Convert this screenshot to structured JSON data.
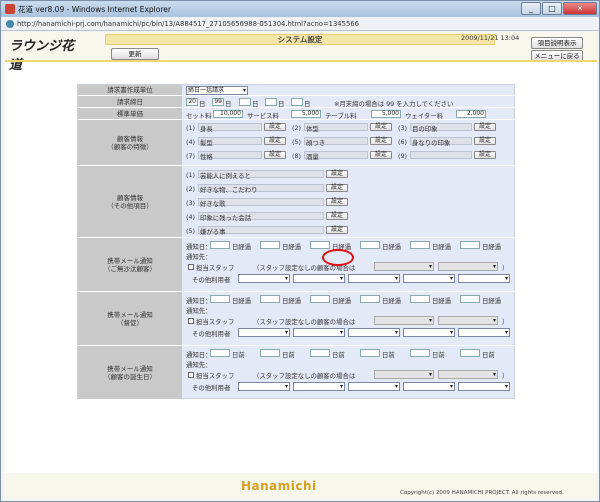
{
  "window": {
    "title": "花道 ver8.09 - Windows Internet Explorer",
    "minimize": "_",
    "maximize": "□",
    "close": "✕"
  },
  "address": {
    "url": "http://hanamichi-prj.com/hanamichi/pc/bin/13/A884517_27105656988-051304.html?acno=1345566"
  },
  "header": {
    "logo": "ラウンジ花道",
    "title": "システム設定",
    "datetime": "2009/11/21 13:04",
    "refresh": "更新",
    "manual": "項目説明表示",
    "back": "メニューに戻る"
  },
  "billing": {
    "label": "請求書作成単位",
    "value": "締日一括請求"
  },
  "closing": {
    "label": "請求締日",
    "d1": "20",
    "d2": "99",
    "day": "日",
    "note": "※月末締の場合は 99 を入力してください"
  },
  "prices": {
    "label": "標準単価",
    "set_label": "セット料",
    "set_value": "10,000",
    "service_label": "サービス料",
    "service_value": "5,000",
    "table_label": "テーブル料",
    "table_value": "5,000",
    "waiter_label": "ウェイター料",
    "waiter_value": "2,000"
  },
  "customer_features": {
    "label": "顧客情報",
    "sublabel": "（顧客の特徴）",
    "set_btn": "設定",
    "items": [
      {
        "n": "(1)",
        "name": "身長"
      },
      {
        "n": "(2)",
        "name": "体型"
      },
      {
        "n": "(3)",
        "name": "目の印象"
      },
      {
        "n": "(4)",
        "name": "髪型"
      },
      {
        "n": "(5)",
        "name": "顔つき"
      },
      {
        "n": "(6)",
        "name": "身なりの印象"
      },
      {
        "n": "(7)",
        "name": "性格"
      },
      {
        "n": "(8)",
        "name": "酒量"
      },
      {
        "n": "(9)",
        "name": ""
      }
    ]
  },
  "customer_other": {
    "label": "顧客情報",
    "sublabel": "（その他項目）",
    "items": [
      {
        "n": "(1)",
        "name": "芸能人に例えると"
      },
      {
        "n": "(2)",
        "name": "好きな物、こだわり"
      },
      {
        "n": "(3)",
        "name": "好きな歌"
      },
      {
        "n": "(4)",
        "name": "印象に残った会話"
      },
      {
        "n": "(5)",
        "name": "嫌がる事"
      }
    ]
  },
  "mail": {
    "notify_day": "通知日：",
    "notify_to": "通知先：",
    "staff": "担当スタッフ",
    "staff_note": "（スタッフ設定なしの顧客の場合は",
    "close_paren": "）",
    "other": "その他利用者",
    "sections": [
      {
        "label": "携帯メール通知",
        "sublabel": "（ご無沙汰顧客）",
        "unit": "日経過"
      },
      {
        "label": "携帯メール通知",
        "sublabel": "（督促）",
        "unit": "日経過"
      },
      {
        "label": "携帯メール通知",
        "sublabel": "（顧客の誕生日）",
        "unit": "日前"
      }
    ]
  },
  "footer": {
    "brand": "Hanamichi",
    "copyright": "Copyright(c) 2009 HANAMICHI PROJECT. All rights reserved."
  },
  "colors": {
    "accent": "#f3e6a8",
    "form_bg": "#e3e9f6",
    "label_bg": "#c9c9c9",
    "highlight": "#dd1111"
  }
}
